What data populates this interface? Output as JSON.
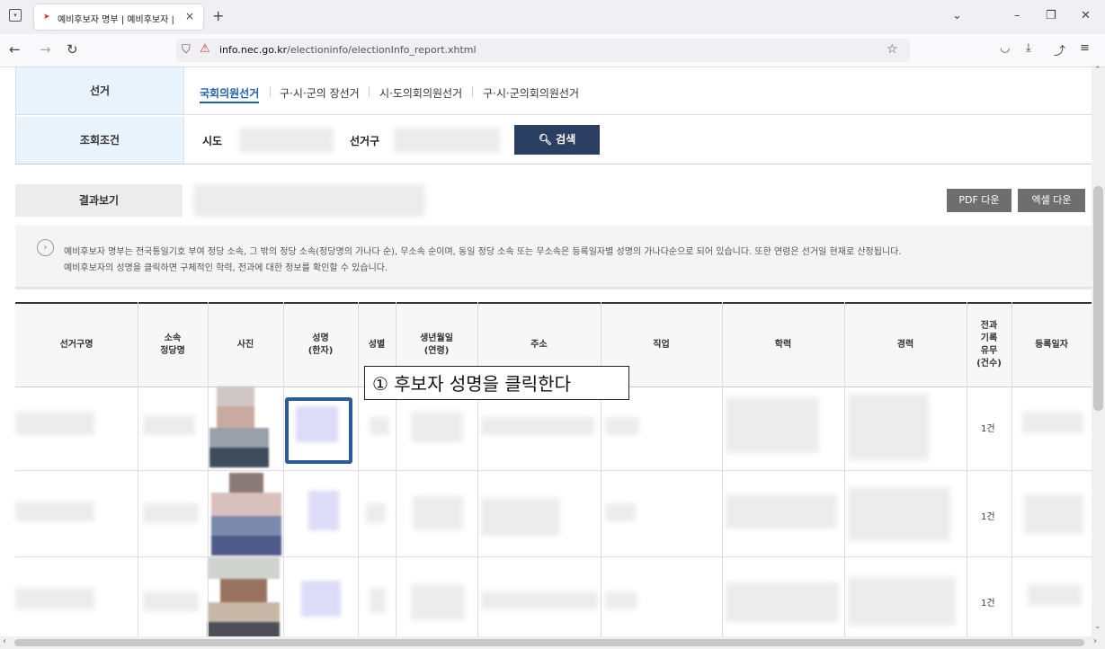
{
  "browser": {
    "tab_title": "예비후보자 명부 | 예비후보자 |",
    "tab_close": "×",
    "new_tab": "+",
    "url_domain": "info.nec.go.kr",
    "url_path": "/electioninfo/electionInfo_report.xhtml"
  },
  "form": {
    "election_label": "선거",
    "election_tabs": [
      "국회의원선거",
      "구·시·군의 장선거",
      "시·도의회의원선거",
      "구·시·군의회의원선거"
    ],
    "criteria_label": "조회조건",
    "sido_label": "시도",
    "district_label": "선거구",
    "search_button": "검색"
  },
  "results": {
    "label": "결과보기",
    "pdf_button": "PDF 다운",
    "excel_button": "엑셀 다운"
  },
  "notice": {
    "line1": "예비후보자 명부는 전국통일기호 부여 정당 소속, 그 밖의 정당 소속(정당명의 가나다 순), 무소속 순이며, 동일 정당 소속 또는 무소속은 등록일자별 성명의 가나다순으로 되어 있습니다. 또한 연령은 선거일 현재로 산정됩니다.",
    "line2": "예비후보자의 성명을 클릭하면 구체적인 학력, 전과에 대한 정보를 확인할 수 있습니다."
  },
  "table": {
    "headers": [
      "선거구명",
      "소속\n정당명",
      "사진",
      "성명\n(한자)",
      "성별",
      "생년월일\n(연령)",
      "주소",
      "직업",
      "학력",
      "경력",
      "전과\n기록\n유무\n(건수)",
      "등록일자"
    ],
    "rows": [
      {
        "criminal_record": "1건"
      },
      {
        "criminal_record": "1건"
      },
      {
        "criminal_record": "1건"
      }
    ]
  },
  "annotation": {
    "text": "① 후보자 성명을 클릭한다"
  },
  "colors": {
    "accent": "#1c5fb3",
    "search_button": "#2b3f62",
    "highlight_border": "#2b5c97",
    "label_bg": "#e9f3fb"
  }
}
